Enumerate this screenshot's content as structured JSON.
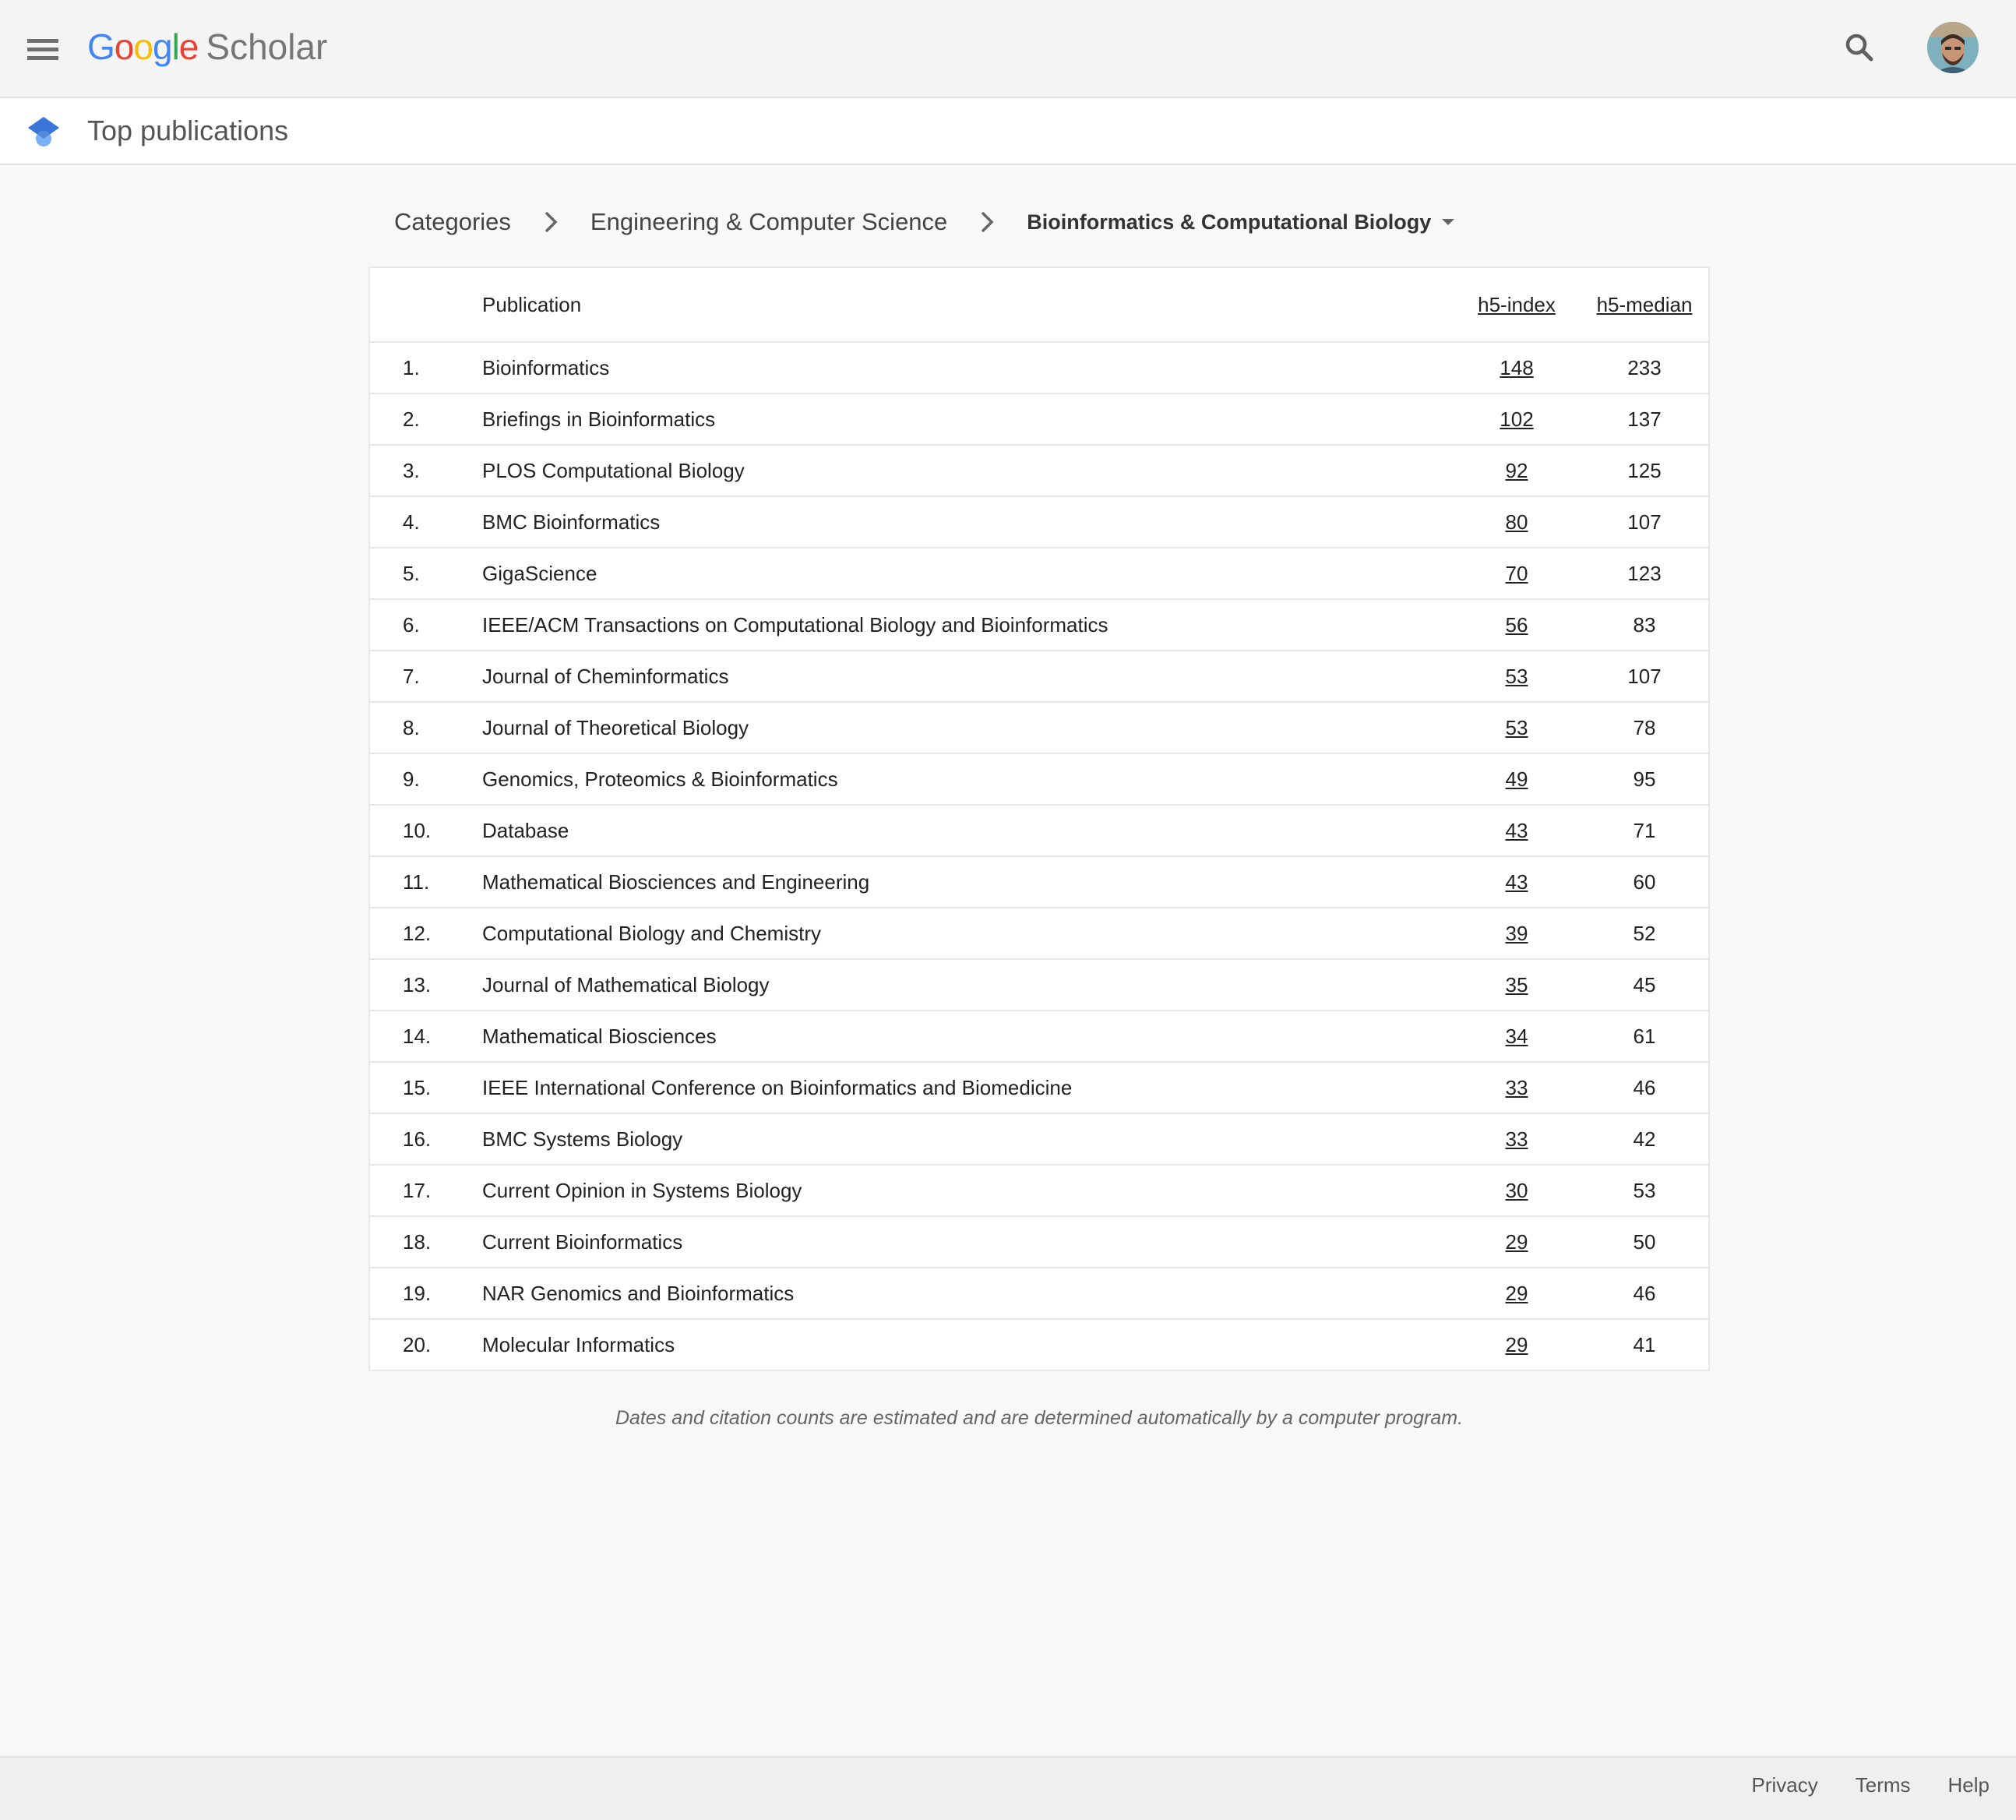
{
  "header": {
    "logo": {
      "brand_letters": [
        {
          "char": "G",
          "color": "#4285F4"
        },
        {
          "char": "o",
          "color": "#EA4335"
        },
        {
          "char": "o",
          "color": "#FBBC05"
        },
        {
          "char": "g",
          "color": "#4285F4"
        },
        {
          "char": "l",
          "color": "#34A853"
        },
        {
          "char": "e",
          "color": "#EA4335"
        }
      ],
      "product": "Scholar"
    },
    "menu_icon": "hamburger-menu-icon",
    "search_icon": "search-icon",
    "avatar_icon": "user-avatar"
  },
  "subheader": {
    "icon": "scholar-cap-icon",
    "title": "Top publications"
  },
  "breadcrumb": {
    "items": [
      "Categories",
      "Engineering & Computer Science"
    ],
    "current": "Bioinformatics & Computational Biology",
    "separator_icon": "chevron-right-icon",
    "dropdown_icon": "dropdown-arrow-icon"
  },
  "table": {
    "columns": {
      "publication": "Publication",
      "h5_index": "h5-index",
      "h5_median": "h5-median"
    },
    "rows": [
      {
        "rank": "1.",
        "publication": "Bioinformatics",
        "h5_index": "148",
        "h5_median": "233"
      },
      {
        "rank": "2.",
        "publication": "Briefings in Bioinformatics",
        "h5_index": "102",
        "h5_median": "137"
      },
      {
        "rank": "3.",
        "publication": "PLOS Computational Biology",
        "h5_index": "92",
        "h5_median": "125"
      },
      {
        "rank": "4.",
        "publication": "BMC Bioinformatics",
        "h5_index": "80",
        "h5_median": "107"
      },
      {
        "rank": "5.",
        "publication": "GigaScience",
        "h5_index": "70",
        "h5_median": "123"
      },
      {
        "rank": "6.",
        "publication": "IEEE/ACM Transactions on Computational Biology and Bioinformatics",
        "h5_index": "56",
        "h5_median": "83"
      },
      {
        "rank": "7.",
        "publication": "Journal of Cheminformatics",
        "h5_index": "53",
        "h5_median": "107"
      },
      {
        "rank": "8.",
        "publication": "Journal of Theoretical Biology",
        "h5_index": "53",
        "h5_median": "78"
      },
      {
        "rank": "9.",
        "publication": "Genomics, Proteomics & Bioinformatics",
        "h5_index": "49",
        "h5_median": "95"
      },
      {
        "rank": "10.",
        "publication": "Database",
        "h5_index": "43",
        "h5_median": "71"
      },
      {
        "rank": "11.",
        "publication": "Mathematical Biosciences and Engineering",
        "h5_index": "43",
        "h5_median": "60"
      },
      {
        "rank": "12.",
        "publication": "Computational Biology and Chemistry",
        "h5_index": "39",
        "h5_median": "52"
      },
      {
        "rank": "13.",
        "publication": "Journal of Mathematical Biology",
        "h5_index": "35",
        "h5_median": "45"
      },
      {
        "rank": "14.",
        "publication": "Mathematical Biosciences",
        "h5_index": "34",
        "h5_median": "61"
      },
      {
        "rank": "15.",
        "publication": "IEEE International Conference on Bioinformatics and Biomedicine",
        "h5_index": "33",
        "h5_median": "46"
      },
      {
        "rank": "16.",
        "publication": "BMC Systems Biology",
        "h5_index": "33",
        "h5_median": "42"
      },
      {
        "rank": "17.",
        "publication": "Current Opinion in Systems Biology",
        "h5_index": "30",
        "h5_median": "53"
      },
      {
        "rank": "18.",
        "publication": "Current Bioinformatics",
        "h5_index": "29",
        "h5_median": "50"
      },
      {
        "rank": "19.",
        "publication": "NAR Genomics and Bioinformatics",
        "h5_index": "29",
        "h5_median": "46"
      },
      {
        "rank": "20.",
        "publication": "Molecular Informatics",
        "h5_index": "29",
        "h5_median": "41"
      }
    ]
  },
  "disclaimer": "Dates and citation counts are estimated and are determined automatically by a computer program.",
  "footer": {
    "links": [
      "Privacy",
      "Terms",
      "Help"
    ]
  },
  "colors": {
    "page_bg": "#f8f8f8",
    "header_bg": "#f4f4f4",
    "table_bg": "#ffffff",
    "cap_blue": "#4285F4"
  }
}
